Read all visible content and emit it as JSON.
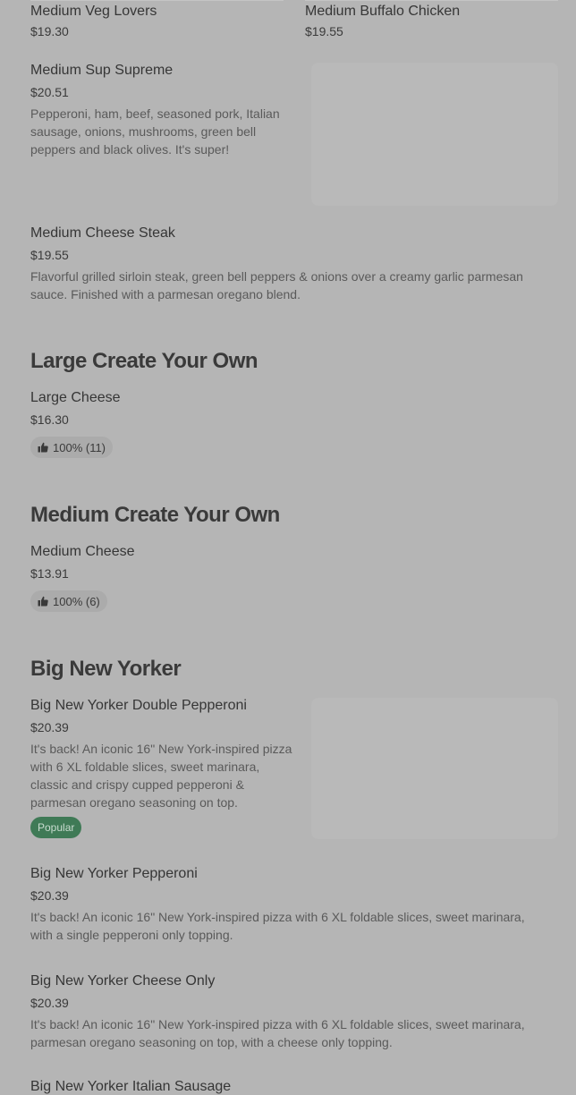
{
  "top_items": [
    {
      "name": "Medium Veg Lovers",
      "price": "$19.30"
    },
    {
      "name": "Medium Buffalo Chicken",
      "price": "$19.55"
    }
  ],
  "items": {
    "sup_supreme": {
      "name": "Medium Sup Supreme",
      "price": "$20.51",
      "desc": "Pepperoni, ham, beef, seasoned pork, Italian sausage, onions, mushrooms, green bell peppers and black olives. It's super!"
    },
    "cheese_steak": {
      "name": "Medium Cheese Steak",
      "price": "$19.55",
      "desc": "Flavorful grilled sirloin steak, green bell peppers & onions over a creamy garlic parmesan sauce. Finished with a parmesan oregano blend."
    }
  },
  "sections": {
    "large_cyo": {
      "title": "Large Create Your Own",
      "item": {
        "name": "Large Cheese",
        "price": "$16.30",
        "rating": "100% (11)"
      }
    },
    "medium_cyo": {
      "title": "Medium Create Your Own",
      "item": {
        "name": "Medium Cheese",
        "price": "$13.91",
        "rating": "100% (6)"
      }
    },
    "big_new_yorker": {
      "title": "Big New Yorker",
      "items": [
        {
          "name": "Big New Yorker Double Pepperoni",
          "price": "$20.39",
          "desc": "It's back! An iconic 16\" New York-inspired pizza with 6 XL foldable slices, sweet marinara, classic and crispy cupped pepperoni & parmesan oregano seasoning on top.",
          "badge": "Popular"
        },
        {
          "name": "Big New Yorker Pepperoni",
          "price": "$20.39",
          "desc": "It's back! An iconic 16\" New York-inspired pizza with 6 XL foldable slices, sweet marinara, with a single pepperoni only topping."
        },
        {
          "name": "Big New Yorker Cheese Only",
          "price": "$20.39",
          "desc": "It's back! An iconic 16\" New York-inspired pizza with 6 XL foldable slices, sweet marinara, parmesan oregano seasoning on top, with a cheese only topping."
        },
        {
          "name": "Big New Yorker Italian Sausage"
        }
      ]
    }
  },
  "icons": {
    "rating": "thumbs-up-icon"
  },
  "colors": {
    "badge_bg": "#3f7a56",
    "overlay_bg": "#b5b5b5"
  }
}
